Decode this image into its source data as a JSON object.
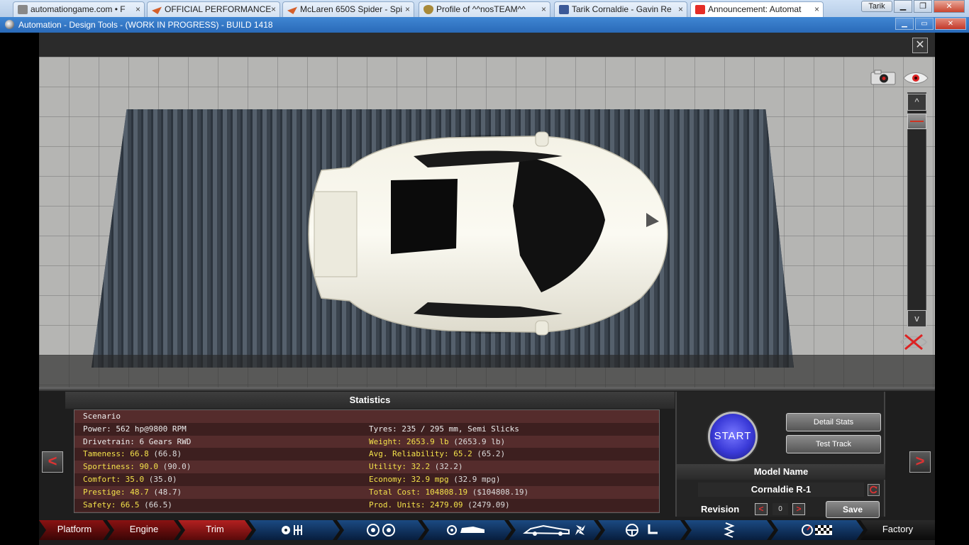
{
  "browser": {
    "tabs": [
      {
        "label": "automationgame.com • F",
        "favicon": "game-favicon",
        "active": false
      },
      {
        "label": "OFFICIAL PERFORMANCE",
        "favicon": "mclaren-favicon",
        "active": false
      },
      {
        "label": "McLaren 650S Spider - Spi",
        "favicon": "mclaren-favicon",
        "active": false
      },
      {
        "label": "Profile of ^^nosTEAM^^",
        "favicon": "shield-favicon",
        "active": false
      },
      {
        "label": "Tarik Cornaldie - Gavin Re",
        "favicon": "facebook-favicon",
        "active": false
      },
      {
        "label": "Announcement: Automat",
        "favicon": "youtube-favicon",
        "active": true
      }
    ],
    "profile_label": "Tarik",
    "close_glyph": "×"
  },
  "window": {
    "title": "Automation - Design Tools - (WORK IN PROGRESS) - BUILD 1418"
  },
  "viewport": {
    "close_glyph": "✕",
    "zoom_up": "^",
    "zoom_down": "v"
  },
  "statistics": {
    "header": "Statistics",
    "rows": [
      {
        "left": "Scenario",
        "left_color": "white",
        "right": "",
        "right_color": "white"
      },
      {
        "left": "Power: 562 hp@9800 RPM",
        "left_color": "white",
        "right": "Tyres: 235 / 295 mm, Semi Slicks",
        "right_color": "white"
      },
      {
        "left": "Drivetrain: 6 Gears RWD",
        "left_color": "white",
        "right": "Weight: 2653.9 lb",
        "right_extra": " (2653.9 lb)",
        "right_color": "yellow"
      },
      {
        "left": "Tameness: 66.8",
        "left_extra": " (66.8)",
        "left_color": "yellow",
        "right": "Avg. Reliability: 65.2",
        "right_extra": " (65.2)",
        "right_color": "yellow"
      },
      {
        "left": "Sportiness: 90.0",
        "left_extra": " (90.0)",
        "left_color": "yellow",
        "right": "Utility: 32.2",
        "right_extra": " (32.2)",
        "right_color": "yellow"
      },
      {
        "left": "Comfort: 35.0",
        "left_extra": " (35.0)",
        "left_color": "yellow",
        "right": "Economy: 32.9 mpg",
        "right_extra": " (32.9 mpg)",
        "right_color": "yellow"
      },
      {
        "left": "Prestige: 48.7",
        "left_extra": " (48.7)",
        "left_color": "yellow",
        "right": "Total Cost: 104808.19",
        "right_extra": " ($104808.19)",
        "right_color": "yellow"
      },
      {
        "left": "Safety: 66.5",
        "left_extra": " (66.5)",
        "left_color": "yellow",
        "right": "Prod. Units: 2479.09",
        "right_extra": " (2479.09)",
        "right_color": "yellow"
      }
    ]
  },
  "panel": {
    "start_label": "START",
    "detail_stats_label": "Detail Stats",
    "test_track_label": "Test Track",
    "model_name_header": "Model Name",
    "model_name_value": "Cornaldie R-1",
    "revision_label": "Revision",
    "revision_value": "0",
    "rev_prev": "<",
    "rev_next": ">",
    "save_label": "Save"
  },
  "nav": {
    "prev_glyph": "<",
    "next_glyph": ">",
    "items": [
      {
        "label": "Platform",
        "style": "red"
      },
      {
        "label": "Engine",
        "style": "red"
      },
      {
        "label": "Trim",
        "style": "red"
      },
      {
        "label": "",
        "icon": "gearbox-icon",
        "style": "blue"
      },
      {
        "label": "",
        "icon": "wheels-icon",
        "style": "blue"
      },
      {
        "label": "",
        "icon": "body-icon",
        "style": "blue"
      },
      {
        "label": "",
        "icon": "aero-icon",
        "style": "blue"
      },
      {
        "label": "",
        "icon": "interior-icon",
        "style": "blue"
      },
      {
        "label": "",
        "icon": "suspension-icon",
        "style": "blue"
      },
      {
        "label": "",
        "icon": "testing-icon",
        "style": "blue"
      },
      {
        "label": "Factory",
        "style": "dark"
      }
    ]
  },
  "colors": {
    "accent_red": "#b32020",
    "stat_yellow": "#f3e14a",
    "start_blue": "#3a3ad8"
  }
}
